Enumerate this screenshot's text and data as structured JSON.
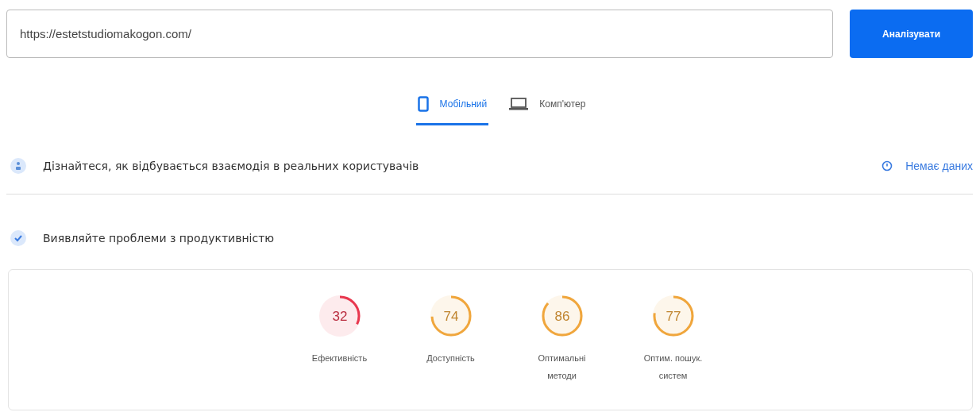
{
  "url_field": {
    "value": "https://estetstudiomakogon.com/"
  },
  "analyze_button": {
    "label": "Аналізувати"
  },
  "tabs": [
    {
      "label": "Мобільний",
      "kind": "phone",
      "selected": true
    },
    {
      "label": "Комп'ютер",
      "kind": "laptop",
      "selected": false
    }
  ],
  "field_data": {
    "title": "Дізнайтеся, як відбувається взаємодія в реальних користувачів",
    "status": "Немає даних"
  },
  "lab_data": {
    "title": "Виявляйте проблеми з продуктивністю"
  },
  "scores": [
    {
      "value": "32",
      "label": "Ефективність",
      "color": "#e8384f"
    },
    {
      "value": "74",
      "label": "Доступність",
      "color": "#f0a63c"
    },
    {
      "value": "86",
      "label": "Оптимальні методи",
      "color": "#f0a63c"
    },
    {
      "value": "77",
      "label": "Оптим. пошук. систем",
      "color": "#f0a63c"
    }
  ]
}
